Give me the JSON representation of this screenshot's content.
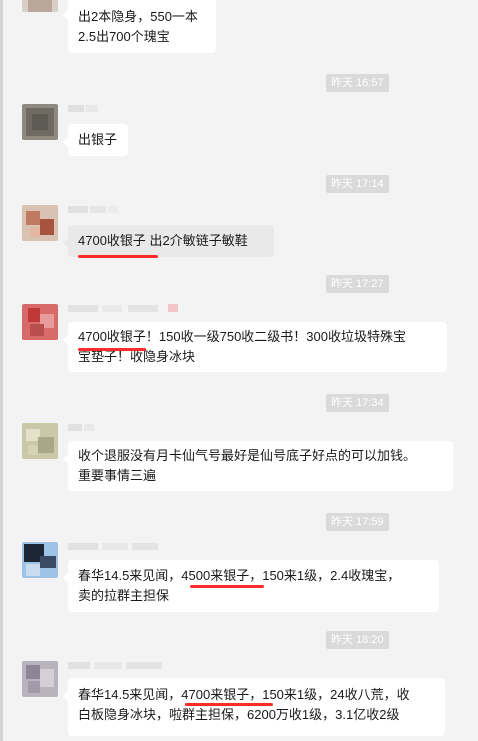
{
  "messages": [
    {
      "lines": [
        "出2本隐身，550一本",
        "2.5出700个瑰宝"
      ]
    },
    {
      "time": "昨天 16:57",
      "lines": [
        "出银子"
      ]
    },
    {
      "time": "昨天 17:14",
      "lines": [
        "4700收银子 出2介敏链子敏鞋"
      ]
    },
    {
      "time": "昨天 17:27",
      "lines": [
        "4700收银子！150收一级750收二级书！300收垃圾特殊宝",
        "宝垫子！收隐身冰块"
      ]
    },
    {
      "time": "昨天 17:34",
      "lines": [
        "收个退服没有月卡仙气号最好是仙号底子好点的可以加钱。",
        "重要事情三遍"
      ]
    },
    {
      "time": "昨天 17:59",
      "lines": [
        "春华14.5来见闻，4500来银子，150来1级，2.4收瑰宝，",
        "卖的拉群主担保"
      ]
    },
    {
      "time": "昨天 18:20",
      "lines": [
        "春华14.5来见闻，4700来银子，150来1级，24收八荒，收",
        "白板隐身冰块，啦群主担保，6200万收1级，3.1亿收2级"
      ]
    }
  ],
  "colors": {
    "background": "#f3f3f3",
    "bubble": "#ffffff",
    "annotation": "#ff2a2a",
    "timestamp_bg": "#dadada"
  }
}
